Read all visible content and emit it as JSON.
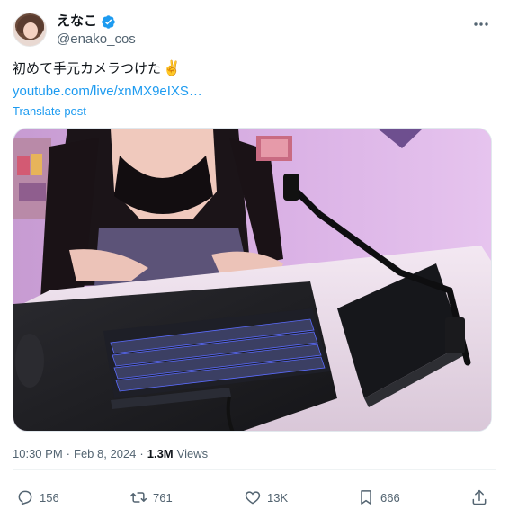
{
  "author": {
    "display_name": "えなこ",
    "handle": "@enako_cos",
    "verified": true,
    "avatar_icon": "avatar-photo"
  },
  "post": {
    "text": "初めて手元カメラつけた",
    "emoji": "✌️",
    "link": "youtube.com/live/xnMX9eIXS…",
    "translate_label": "Translate post",
    "media_description_icon": "camera-desk-photo"
  },
  "meta": {
    "time": "10:30 PM",
    "separator": "·",
    "date": "Feb 8, 2024",
    "dot": "·",
    "views_count": "1.3M",
    "views_label": "Views"
  },
  "actions": {
    "replies": "156",
    "reposts": "761",
    "likes": "13K",
    "bookmarks": "666"
  },
  "colors": {
    "accent": "#1d9bf0",
    "secondary_text": "#536471",
    "keyboard_backlight": "#5b6cff"
  }
}
